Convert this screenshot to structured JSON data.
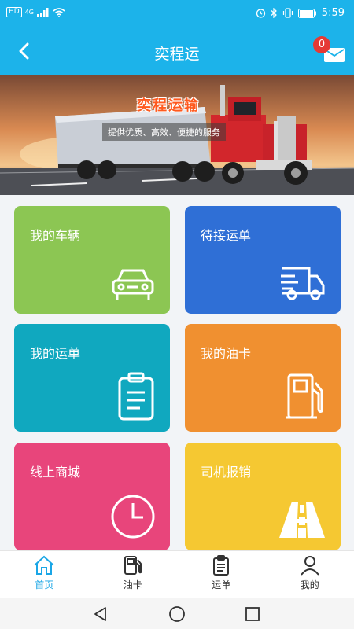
{
  "status_bar": {
    "left_tag": "HD",
    "network": "4G",
    "time": "5:59"
  },
  "nav": {
    "title": "奕程运",
    "message_badge": "0"
  },
  "banner": {
    "title": "奕程运输",
    "subtitle": "提供优质、高效、便捷的服务"
  },
  "tiles": [
    {
      "label": "我的车辆",
      "color": "#8cc653",
      "icon": "car-icon"
    },
    {
      "label": "待接运单",
      "color": "#2f6fd6",
      "icon": "delivery-truck-icon"
    },
    {
      "label": "我的运单",
      "color": "#10a8bf",
      "icon": "clipboard-icon"
    },
    {
      "label": "我的油卡",
      "color": "#f09030",
      "icon": "fuel-pump-icon"
    },
    {
      "label": "线上商城",
      "color": "#e8457b",
      "icon": "clock-icon"
    },
    {
      "label": "司机报销",
      "color": "#f5c832",
      "icon": "road-icon"
    }
  ],
  "tabbar": {
    "active_color": "#1aa6e6",
    "items": [
      {
        "label": "首页",
        "icon": "home-icon"
      },
      {
        "label": "油卡",
        "icon": "fuel-pump-icon"
      },
      {
        "label": "运单",
        "icon": "clipboard-icon"
      },
      {
        "label": "我的",
        "icon": "user-icon"
      }
    ]
  }
}
